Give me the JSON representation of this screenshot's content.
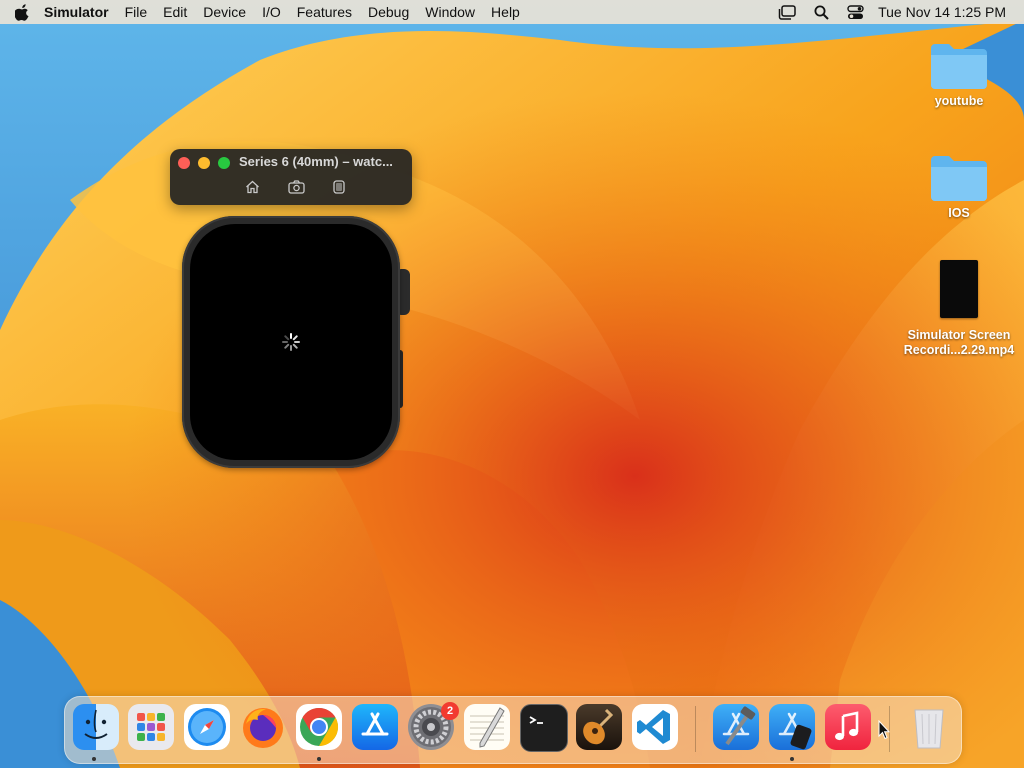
{
  "menubar": {
    "app_name": "Simulator",
    "menus": [
      "File",
      "Edit",
      "Device",
      "I/O",
      "Features",
      "Debug",
      "Window",
      "Help"
    ],
    "clock": "Tue Nov 14  1:25 PM",
    "status_icons": [
      "stage-manager-icon",
      "spotlight-search-icon",
      "control-center-icon"
    ]
  },
  "desktop": {
    "icons": [
      {
        "label": "youtube",
        "type": "folder"
      },
      {
        "label": "IOS",
        "type": "folder"
      },
      {
        "label": "Simulator Screen Recordi...2.29.mp4",
        "type": "video-file"
      }
    ]
  },
  "simulator": {
    "title": "Series 6 (40mm) – watc...",
    "tools": [
      "home-icon",
      "screenshot-icon",
      "rotate-device-icon"
    ],
    "screen_state": "loading"
  },
  "dock": {
    "apps": [
      {
        "name": "Finder",
        "running": true
      },
      {
        "name": "Launchpad",
        "running": false
      },
      {
        "name": "Safari",
        "running": false
      },
      {
        "name": "Firefox",
        "running": false
      },
      {
        "name": "Chrome",
        "running": true
      },
      {
        "name": "App Store",
        "running": false
      },
      {
        "name": "System Settings",
        "running": false,
        "badge": "2"
      },
      {
        "name": "TextEdit",
        "running": false
      },
      {
        "name": "Terminal",
        "running": false
      },
      {
        "name": "GarageBand",
        "running": false
      },
      {
        "name": "Visual Studio Code",
        "running": false
      },
      {
        "name": "Xcode",
        "running": false
      },
      {
        "name": "Simulator",
        "running": true
      },
      {
        "name": "Music",
        "running": false
      },
      {
        "name": "Trash",
        "running": false
      }
    ]
  },
  "colors": {
    "wallpaper_orange": "#f5a21a",
    "wallpaper_blue": "#3a8fd6",
    "close": "#fe5f57",
    "minimize": "#febc2e",
    "zoom": "#28c840",
    "badge": "#f23b30"
  }
}
